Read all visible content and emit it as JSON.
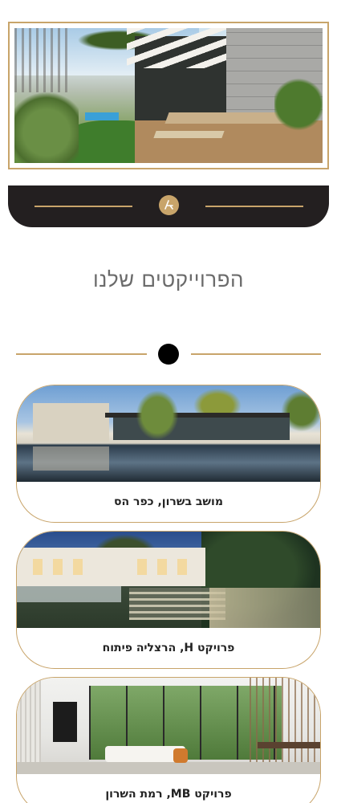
{
  "hero": {
    "image_alt": "garden-patio-photo",
    "border_color": "#c8a46a"
  },
  "logo": {
    "icon": "logo-icon",
    "color": "#c8a46a",
    "bar_color": "#231f20"
  },
  "section": {
    "title": "הפרוייקטים שלנו"
  },
  "projects": [
    {
      "label": "מושב בשרון, כפר הס",
      "image": "villa-with-pool-photo"
    },
    {
      "label": "פרויקט H, הרצליה פיתוח",
      "image": "villa-night-garden-photo"
    },
    {
      "label": "פרויקט MB, רמת השרון",
      "image": "interior-living-room-photo"
    }
  ]
}
